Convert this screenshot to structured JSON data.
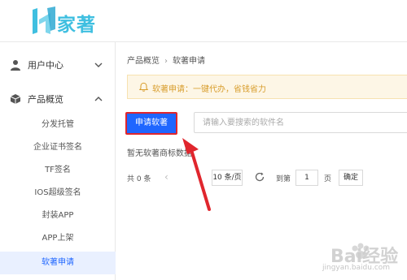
{
  "brand": {
    "logo_text": "家著",
    "logo_color": "#3fbfe0"
  },
  "sidebar": {
    "groups": [
      {
        "label": "用户中心",
        "icon": "user-icon",
        "expanded": false
      },
      {
        "label": "产品概览",
        "icon": "cube-icon",
        "expanded": true
      }
    ],
    "items": [
      {
        "label": "分发托管"
      },
      {
        "label": "企业证书签名"
      },
      {
        "label": "TF签名"
      },
      {
        "label": "IOS超级签名"
      },
      {
        "label": "封装APP"
      },
      {
        "label": "APP上架"
      },
      {
        "label": "软著申请",
        "active": true
      }
    ]
  },
  "breadcrumb": {
    "parent": "产品概览",
    "separator": "›",
    "current": "软著申请"
  },
  "notice": {
    "icon": "bell-icon",
    "text": "软著申请：一键代办，省钱省力"
  },
  "toolbar": {
    "apply_label": "申请软著",
    "search_placeholder": "请输入要搜索的软件名"
  },
  "list": {
    "empty_text": "暂无软著商标数据"
  },
  "pager": {
    "total_label": "共 0 条",
    "page_size": "10 条/页",
    "goto_label": "到第",
    "page_value": "1",
    "page_unit": "页",
    "confirm_label": "确定"
  },
  "watermark": {
    "text": "Bai经验",
    "sub": "jingyan.baidu.com"
  },
  "colors": {
    "accent": "#1f66ff",
    "highlight_border": "#e0262d",
    "arrow": "#e0262d",
    "notice_bg": "#fdf6e6",
    "notice_text": "#d89d2c"
  }
}
